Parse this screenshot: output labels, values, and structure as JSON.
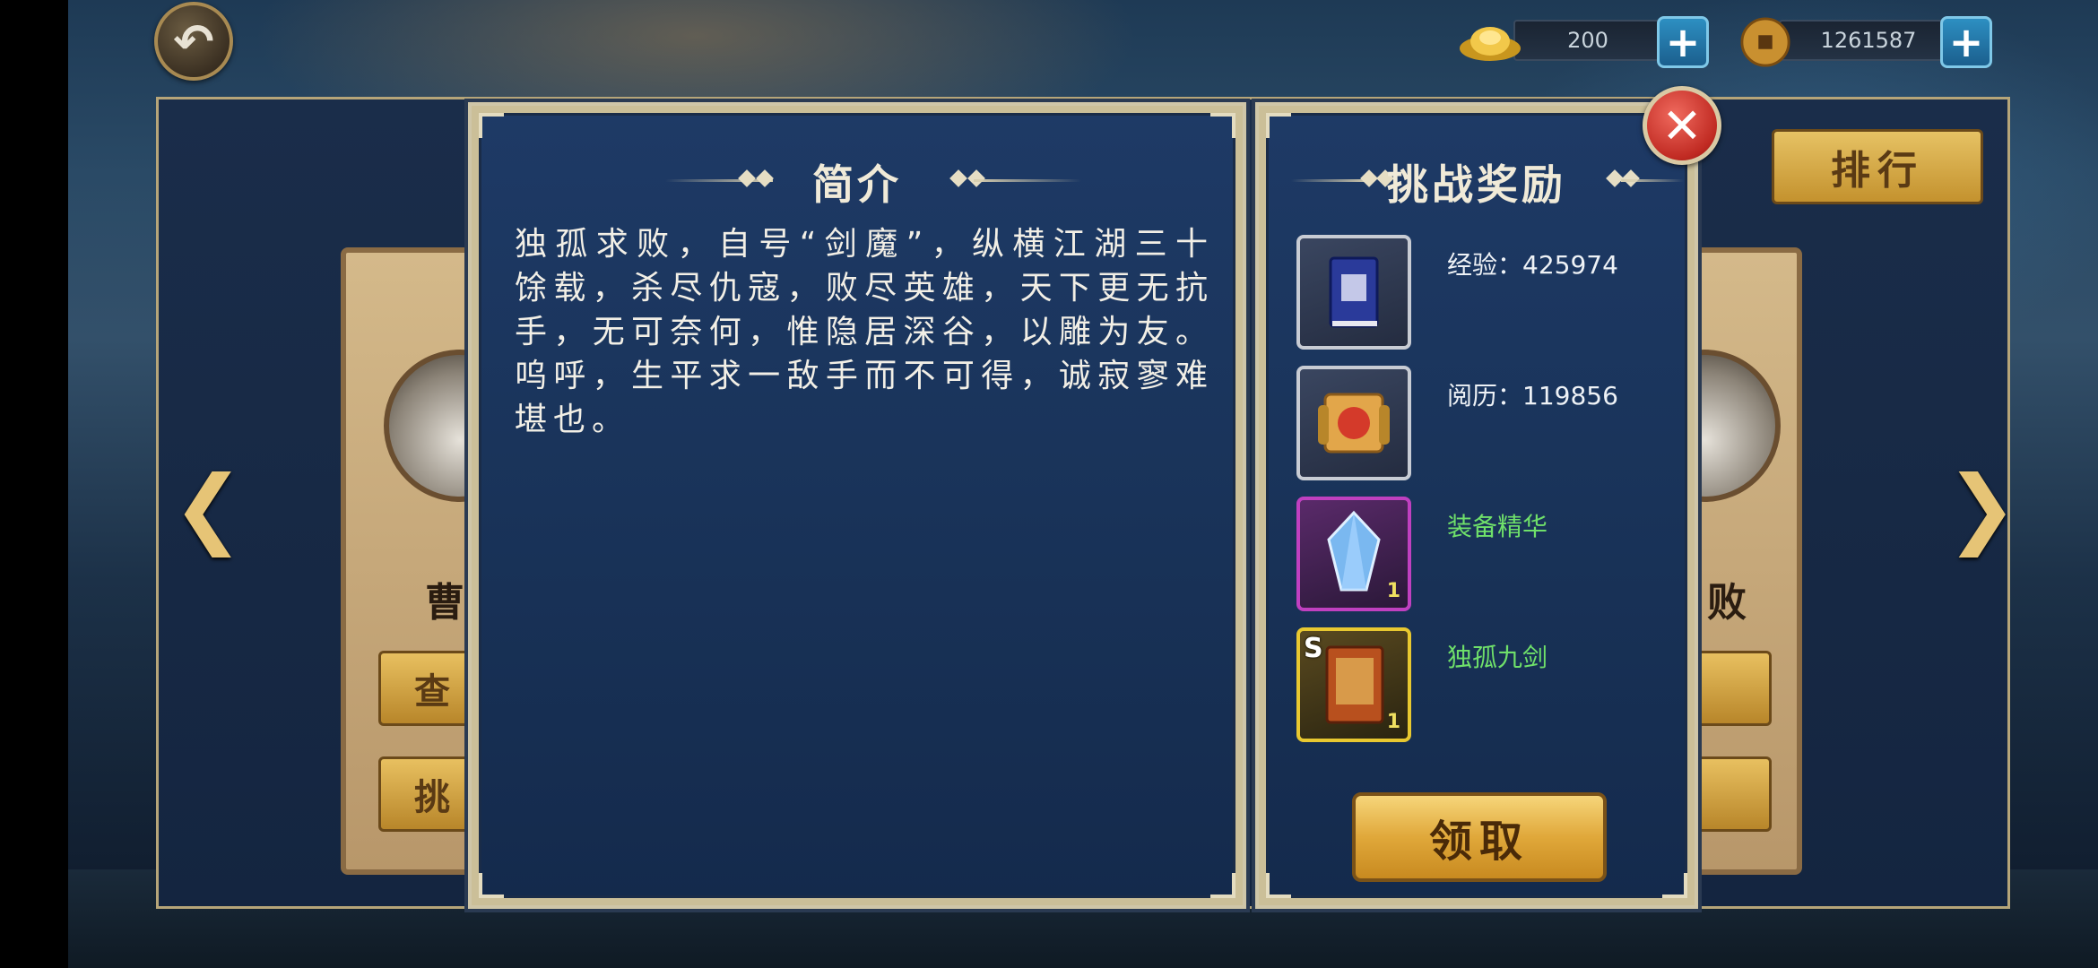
{
  "header": {
    "gold_amount": "200",
    "coin_amount": "1261587",
    "back_icon": "back-arrow-icon",
    "plus_icon": "plus-icon"
  },
  "side": {
    "left_name": "曹",
    "left_button_1": "查",
    "left_button_2": "挑",
    "right_name": "败",
    "rank_label": "排行"
  },
  "intro": {
    "title": "简介",
    "text": "独孤求败，自号“剑魔”，纵横江湖三十馀载，杀尽仇寇，败尽英雄，天下更无抗手，无可奈何，惟隐居深谷，以雕为友。呜呼，生平求一敌手而不可得，诚寂寥难堪也。"
  },
  "reward": {
    "title": "挑战奖励",
    "items": [
      {
        "label": "经验：425974",
        "icon": "blue-book-icon",
        "qty": "",
        "grade": ""
      },
      {
        "label": "阅历：119856",
        "icon": "scroll-icon",
        "qty": "",
        "grade": ""
      },
      {
        "label": "装备精华",
        "icon": "crystal-icon",
        "qty": "1",
        "grade": ""
      },
      {
        "label": "独孤九剑",
        "icon": "martial-arts-book-icon",
        "qty": "1",
        "grade": "S"
      }
    ],
    "claim_label": "领取"
  },
  "colors": {
    "purple_frame": "#c040c0",
    "gold_frame": "#e8c830",
    "green_text": "#6fe06a"
  }
}
